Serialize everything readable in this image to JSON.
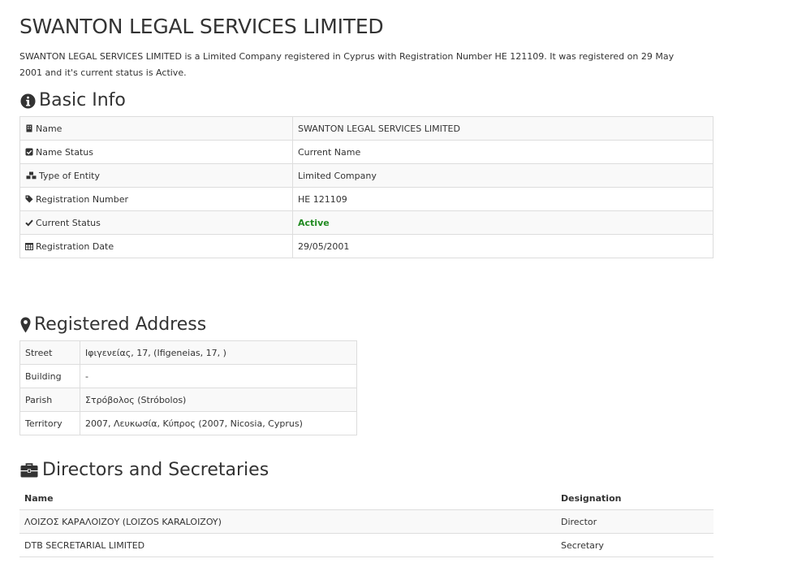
{
  "company": {
    "title": "SWANTON LEGAL SERVICES LIMITED",
    "description": "SWANTON LEGAL SERVICES LIMITED is a Limited Company registered in Cyprus with Registration Number HE 121109. It was registered on 29 May 2001 and it's current status is Active."
  },
  "basic_info": {
    "heading": "Basic Info",
    "rows": [
      {
        "label": "Name",
        "value": "SWANTON LEGAL SERVICES LIMITED",
        "icon": "building-icon"
      },
      {
        "label": "Name Status",
        "value": "Current Name",
        "icon": "check-square-icon"
      },
      {
        "label": "Type of Entity",
        "value": "Limited Company",
        "icon": "cubes-icon"
      },
      {
        "label": "Registration Number",
        "value": "HE 121109",
        "icon": "tag-icon"
      },
      {
        "label": "Current Status",
        "value": "Active",
        "icon": "check-icon"
      },
      {
        "label": "Registration Date",
        "value": "29/05/2001",
        "icon": "calendar-icon"
      }
    ]
  },
  "address": {
    "heading": "Registered Address",
    "rows": [
      {
        "label": "Street",
        "value": "Ιφιγενείας, 17, (Ifigeneias, 17, )"
      },
      {
        "label": "Building",
        "value": "-"
      },
      {
        "label": "Parish",
        "value": "Στρόβολος (Stróbolos)"
      },
      {
        "label": "Territory",
        "value": "2007, Λευκωσία, Κύπρος (2007, Nicosia, Cyprus)"
      }
    ]
  },
  "directors": {
    "heading": "Directors and Secretaries",
    "columns": [
      "Name",
      "Designation"
    ],
    "rows": [
      {
        "name": "ΛΟΙΖΟΣ ΚΑΡΑΛΟΙΖΟΥ (LOIZOS KARALOIZOY)",
        "designation": "Director"
      },
      {
        "name": "DTB SECRETARIAL LIMITED",
        "designation": "Secretary"
      }
    ]
  },
  "colors": {
    "text": "#333333",
    "active_status": "#228b22",
    "border": "#dddddd",
    "stripe": "#f9f9f9"
  }
}
